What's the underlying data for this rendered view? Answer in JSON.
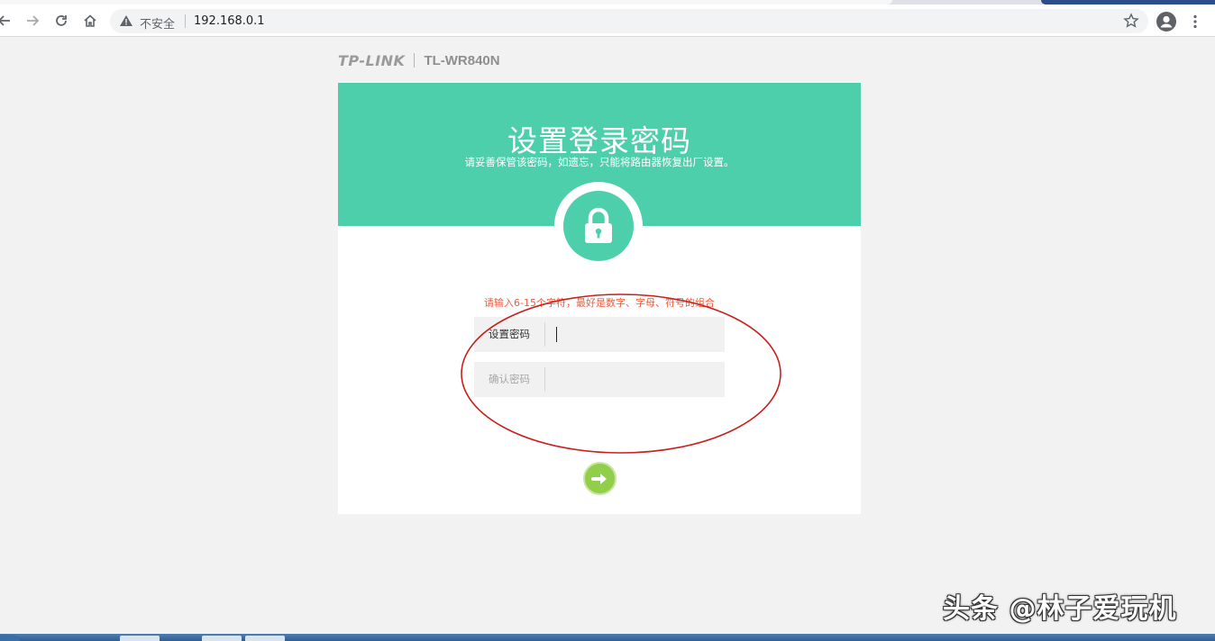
{
  "browser": {
    "security_label": "不安全",
    "url": "192.168.0.1"
  },
  "brand": {
    "logo": "TP-LINK",
    "model": "TL-WR840N"
  },
  "page": {
    "title": "设置登录密码",
    "subtitle": "请妥善保管该密码，如遗忘，只能将路由器恢复出厂设置。",
    "hint": "请输入6-15个字符，最好是数字、字母、符号的组合",
    "password_label": "设置密码",
    "password_value": "",
    "confirm_label": "确认密码",
    "confirm_value": ""
  },
  "watermark": "头条 @林子爱玩机",
  "colors": {
    "header_green": "#4ecfac",
    "hint_red": "#ef5a3a",
    "next_button": "#91cf4a",
    "annotation_circle": "#c8201c"
  },
  "icons": {
    "back": "back-arrow-icon",
    "forward": "forward-arrow-icon",
    "reload": "reload-icon",
    "home": "home-icon",
    "warning": "warning-triangle-icon",
    "bookmark": "star-icon",
    "account": "account-icon",
    "menu": "kebab-menu-icon",
    "lock": "lock-icon",
    "next": "arrow-right-icon"
  }
}
